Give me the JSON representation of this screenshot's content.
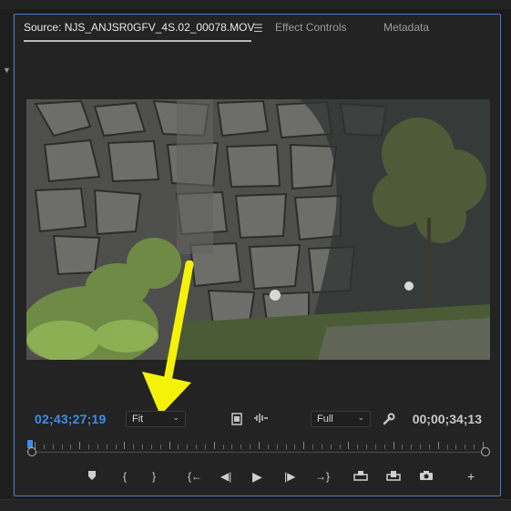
{
  "tabs": [
    {
      "label": "Source: NJS_ANJSR0GFV_4S.02_00078.MOV",
      "active": true
    },
    {
      "label": "Effect Controls",
      "active": false
    },
    {
      "label": "Metadata",
      "active": false
    }
  ],
  "tab_menu_icon": "hamburger-menu-icon",
  "monitor": {
    "current_timecode": "02;43;27;19",
    "duration_timecode": "00;00;34;13",
    "zoom": {
      "selected": "Fit"
    },
    "resolution": {
      "selected": "Full"
    },
    "icons": {
      "insert_frame": "film-strip-icon",
      "drag_audio": "waveform-icon",
      "settings": "wrench-icon"
    }
  },
  "transport": [
    {
      "name": "add-marker-button",
      "glyph": "⬟"
    },
    {
      "name": "mark-in-button",
      "glyph": "{"
    },
    {
      "name": "mark-out-button",
      "glyph": "}"
    },
    {
      "name": "go-to-in-button",
      "glyph": "{←"
    },
    {
      "name": "step-back-button",
      "glyph": "◀|"
    },
    {
      "name": "play-button",
      "glyph": "▶"
    },
    {
      "name": "step-forward-button",
      "glyph": "|▶"
    },
    {
      "name": "go-to-out-button",
      "glyph": "→}"
    },
    {
      "name": "insert-button",
      "glyph": "⧉"
    },
    {
      "name": "overwrite-button",
      "glyph": "⬓"
    },
    {
      "name": "export-frame-button",
      "glyph": "📷"
    },
    {
      "name": "button-editor-button",
      "glyph": "+"
    }
  ],
  "colors": {
    "accent_blue": "#3d8ee6",
    "panel_border": "#3f7fd0",
    "annotation_arrow": "#f5f20a"
  }
}
